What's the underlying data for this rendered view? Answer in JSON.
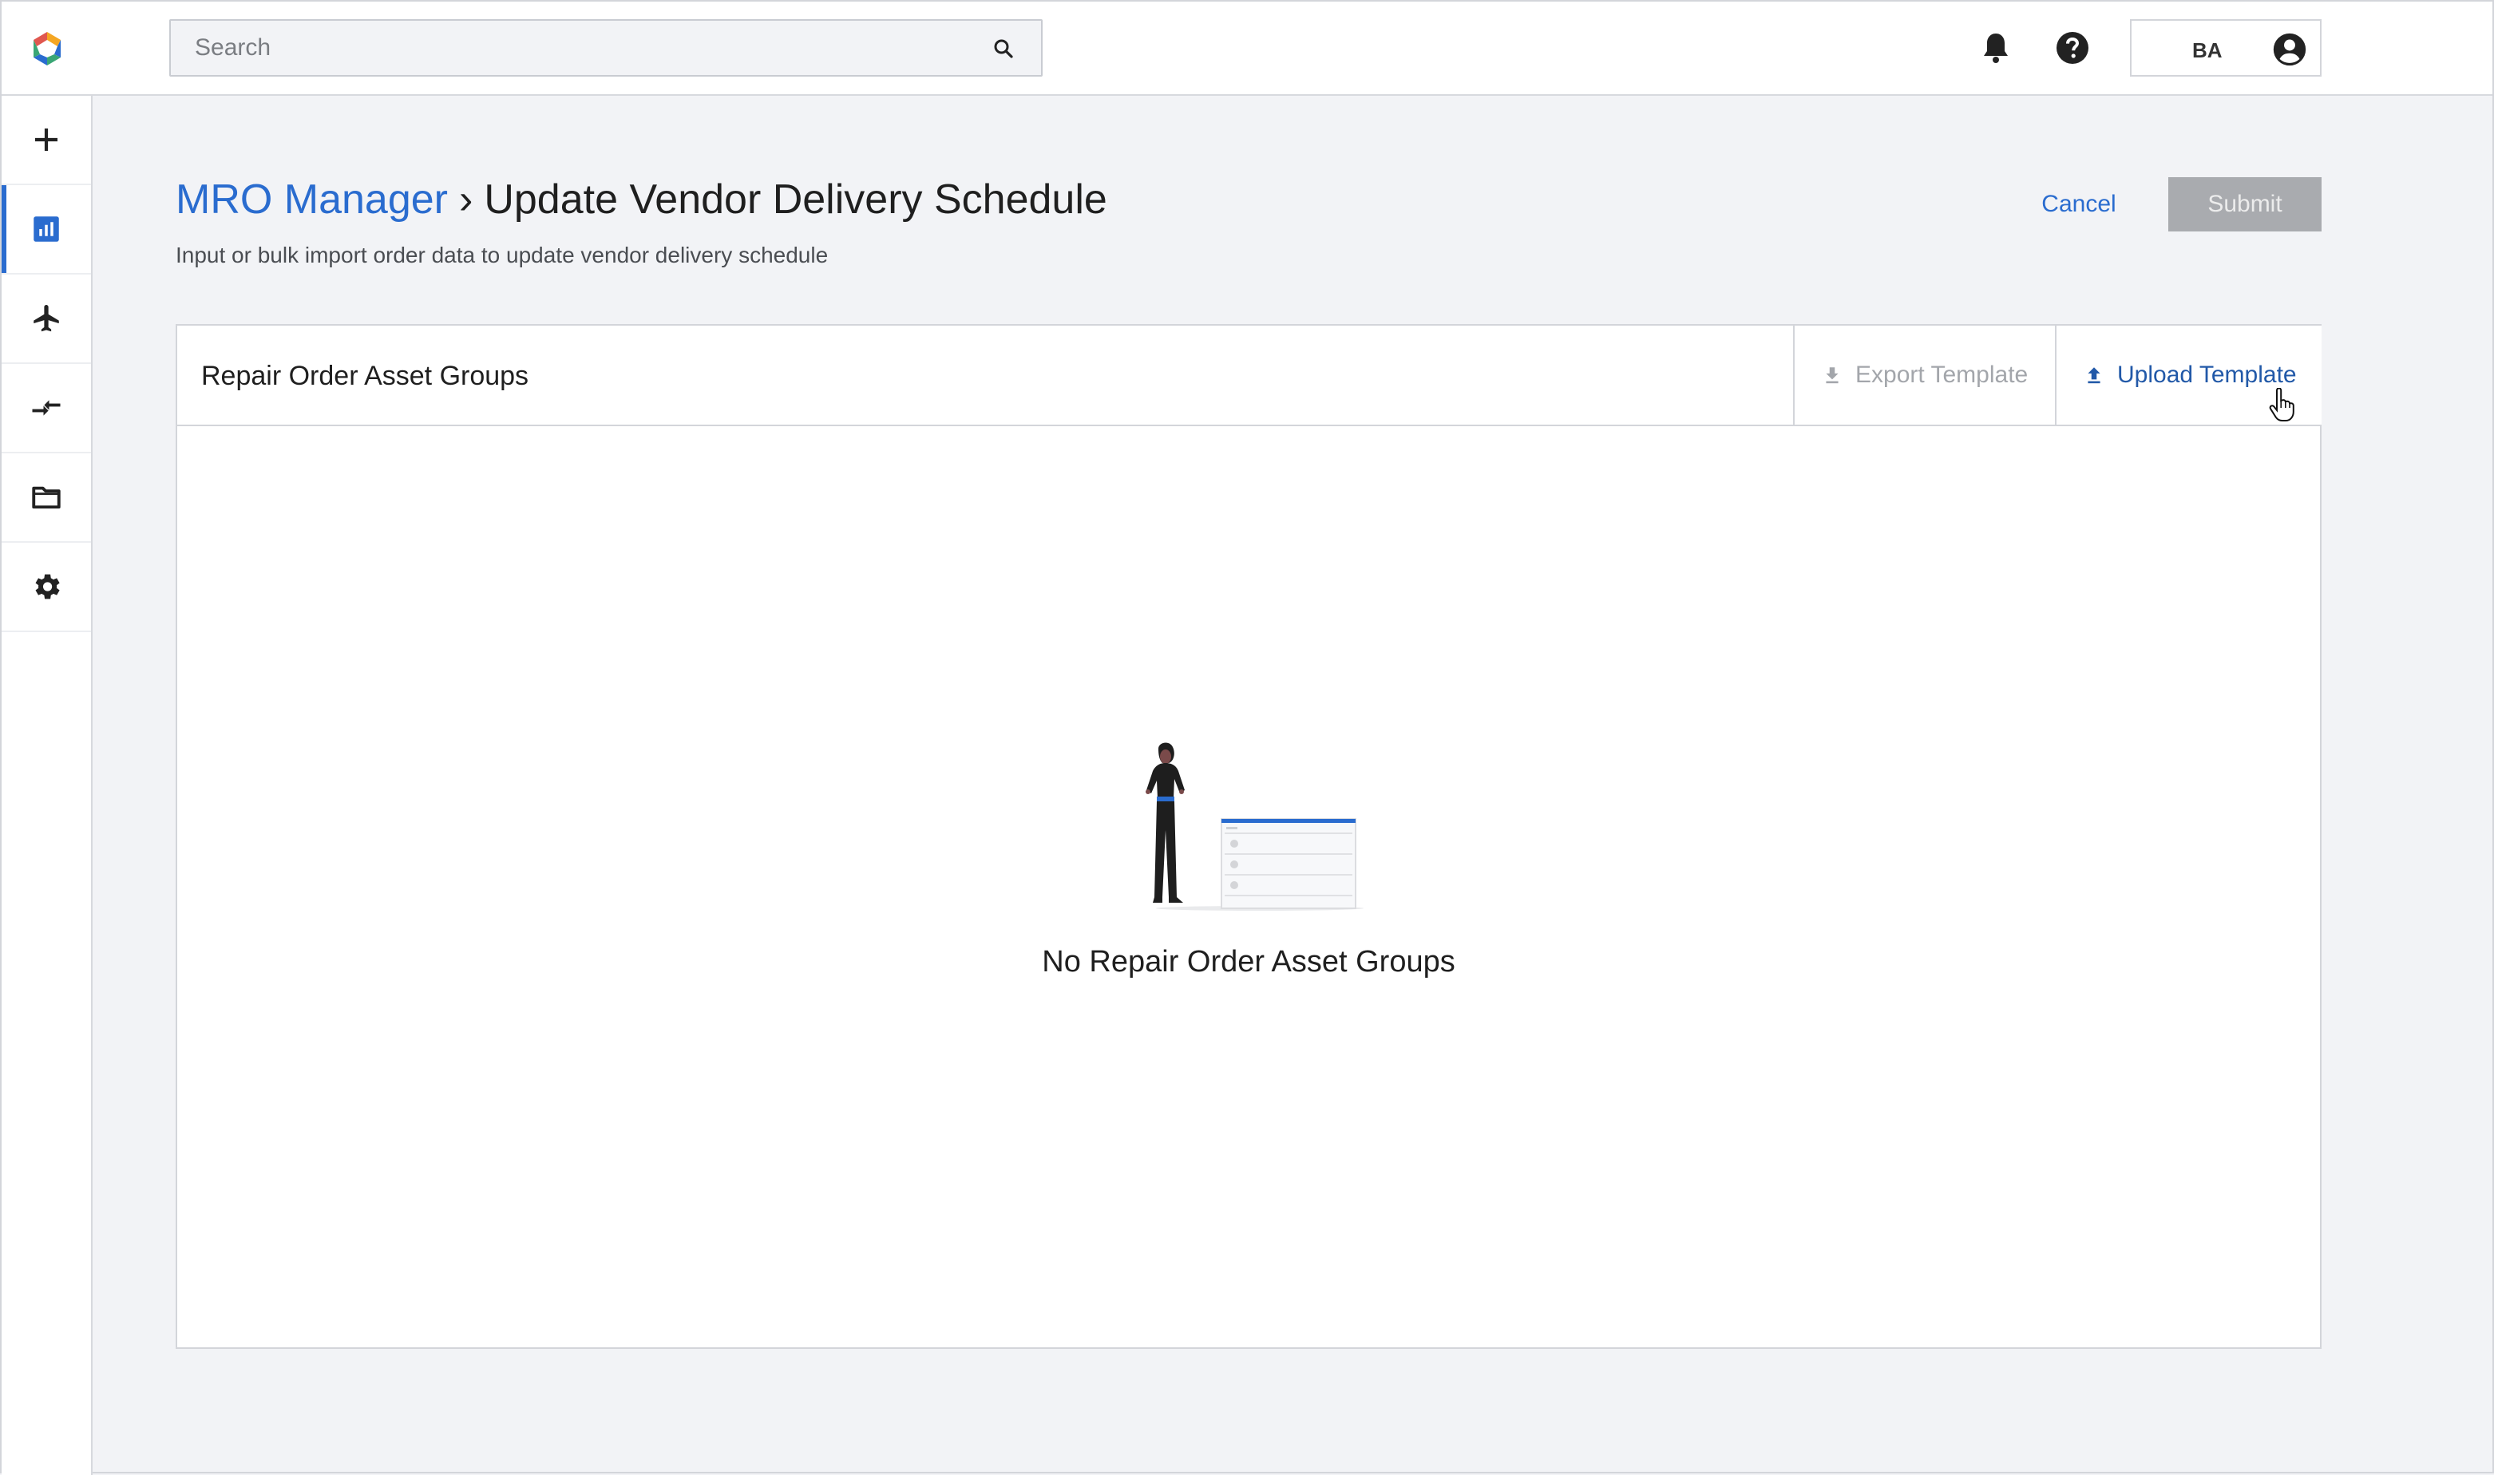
{
  "topbar": {
    "logo_icon": "app-logo-icon",
    "search": {
      "placeholder": "Search",
      "value": ""
    },
    "notifications_icon": "bell-icon",
    "help_icon": "help-circle-icon",
    "user": {
      "initials": "BA",
      "avatar_icon": "account-circle-icon"
    }
  },
  "sidebar": {
    "items": [
      {
        "name": "create",
        "icon": "plus-icon",
        "active": false
      },
      {
        "name": "dashboard",
        "icon": "chart-icon",
        "active": true
      },
      {
        "name": "flights",
        "icon": "airplane-icon",
        "active": false
      },
      {
        "name": "transfers",
        "icon": "arrows-compare-icon",
        "active": false
      },
      {
        "name": "files",
        "icon": "folder-icon",
        "active": false
      },
      {
        "name": "settings",
        "icon": "gear-icon",
        "active": false
      }
    ],
    "accent_color": "#2a6ccf"
  },
  "header": {
    "breadcrumb_link": "MRO Manager",
    "breadcrumb_separator": "›",
    "title": "Update Vendor Delivery Schedule",
    "subtitle": "Input or bulk import order data to update vendor delivery schedule",
    "cancel_label": "Cancel",
    "submit_label": "Submit"
  },
  "panel": {
    "title": "Repair Order Asset Groups",
    "export_label": "Export Template",
    "upload_label": "Upload Template",
    "empty_message": "No Repair Order Asset Groups"
  }
}
